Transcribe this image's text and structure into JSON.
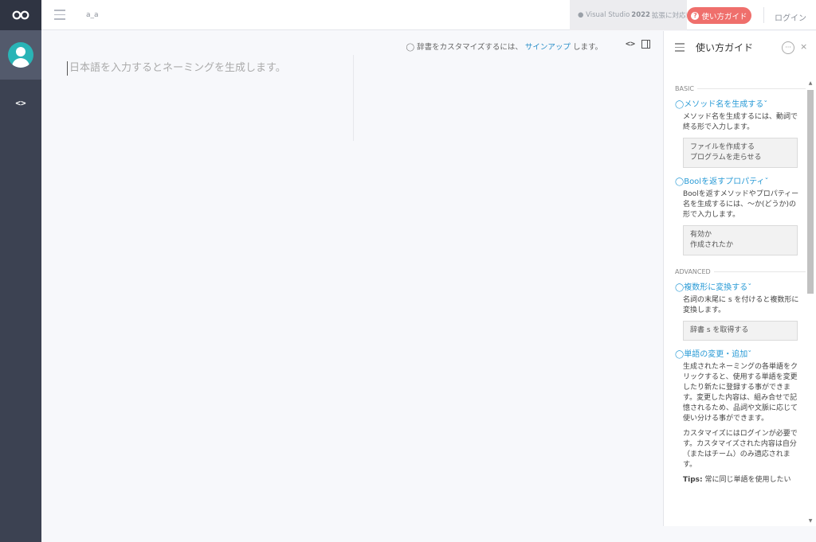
{
  "app": {
    "user_id": "a_a"
  },
  "topbar": {
    "vs_prefix": "Visual Studio",
    "vs_version": "2022",
    "vs_suffix": "拡張に対応!",
    "guide_label": "使い方ガイド",
    "login_label": "ログイン"
  },
  "main": {
    "hint_prefix": "辞書をカスタマイズするには、",
    "hint_link": "サインアップ",
    "hint_suffix": "します。",
    "placeholder": "日本語を入力するとネーミングを生成します。"
  },
  "guide": {
    "title": "使い方ガイド",
    "more": "···",
    "close": "×",
    "sections": {
      "basic": "BASIC",
      "advanced": "ADVANCED"
    },
    "method": {
      "title": "メソッド名を生成する",
      "desc": "メソッド名を生成するには、動詞で終る形で入力します。",
      "ex1": "ファイルを作成する",
      "ex2": "プログラムを走らせる"
    },
    "bool": {
      "title": "Boolを返すプロパティ",
      "desc": "Boolを返すメソッドやプロパティー名を生成するには、〜か(どうか)の形で入力します。",
      "ex1": "有効か",
      "ex2": "作成されたか"
    },
    "plural": {
      "title": "複数形に変換する",
      "desc": "名詞の末尾に s を付けると複数形に変換します。",
      "ex1": "辞書 s を取得する"
    },
    "word": {
      "title": "単語の変更・追加",
      "desc1": "生成されたネーミングの各単語をクリックすると、使用する単語を変更したり新たに登録する事ができます。変更した内容は、組み合せで記憶されるため、品詞や文脈に応じて使い分ける事ができます。",
      "desc2": "カスタマイズにはログインが必要です。カスタマイズされた内容は自分（またはチーム）のみ適応されます。",
      "tips_label": "Tips:",
      "tips_text": "常に同じ単語を使用したい"
    }
  },
  "colors": {
    "rail": "#3c4252",
    "accent": "#ef6f6c",
    "link": "#2a9bd6",
    "avatar": "#29b4b6"
  }
}
